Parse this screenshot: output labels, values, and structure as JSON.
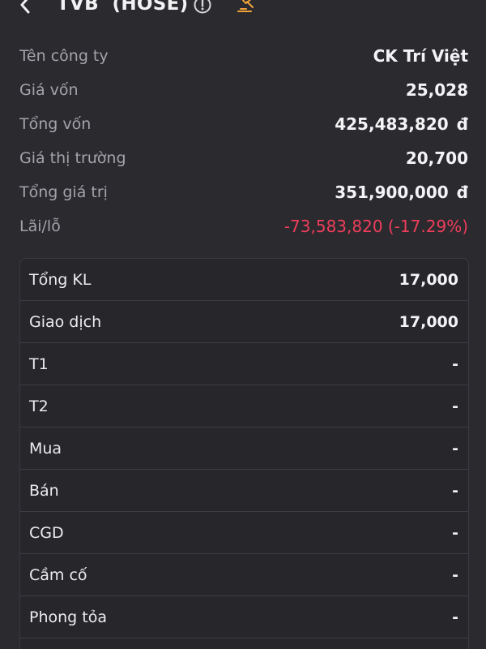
{
  "header": {
    "title": "TVB  (HOSE)",
    "icons": [
      "back-arrow-icon",
      "info-icon",
      "auction-gavel-icon"
    ],
    "accent_color": "#f2a33a"
  },
  "summary": [
    {
      "label": "Tên công ty",
      "value": "CK Trí Việt"
    },
    {
      "label": "Giá vốn",
      "value": "25,028"
    },
    {
      "label": "Tổng vốn",
      "value": "425,483,820",
      "currency": "đ"
    },
    {
      "label": "Giá thị trường",
      "value": "20,700"
    },
    {
      "label": "Tổng giá trị",
      "value": "351,900,000",
      "currency": "đ"
    },
    {
      "label": "Lãi/lỗ",
      "value": "-73,583,820 (-17.29%)",
      "status_color": "#ef3e5a"
    }
  ],
  "holdings": [
    {
      "label": "Tổng KL",
      "value": "17,000"
    },
    {
      "label": "Giao dịch",
      "value": "17,000"
    },
    {
      "label": "T1",
      "value": "-"
    },
    {
      "label": "T2",
      "value": "-"
    },
    {
      "label": "Mua",
      "value": "-"
    },
    {
      "label": "Bán",
      "value": "-"
    },
    {
      "label": "CGD",
      "value": "-"
    },
    {
      "label": "Cầm cố",
      "value": "-"
    },
    {
      "label": "Phong tỏa",
      "value": "-"
    }
  ]
}
